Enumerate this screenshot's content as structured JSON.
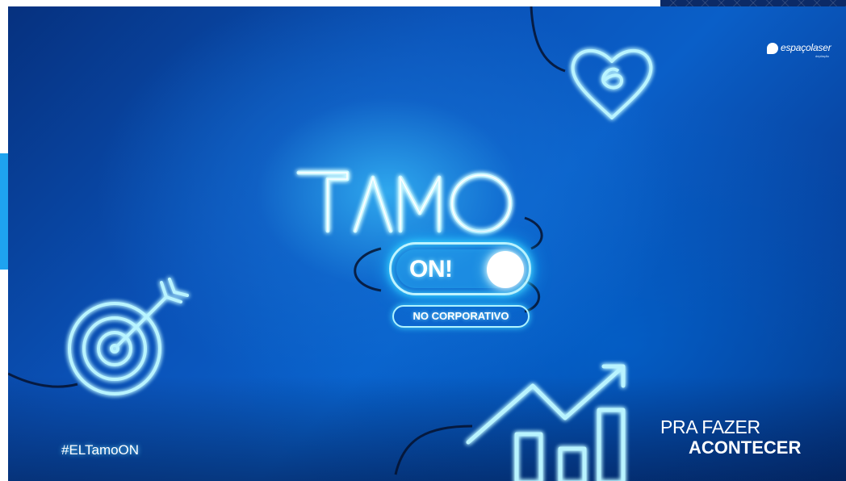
{
  "brand": {
    "logo_text": "espaçolaser",
    "logo_sub": "depilação",
    "accent": "#1ea3f0",
    "neon": "#8feaff"
  },
  "hero": {
    "title_word": "TAMO",
    "toggle_label": "ON!",
    "pill_text": "NO CORPORATIVO"
  },
  "footer": {
    "hashtag": "#ELTamoON",
    "tagline_line1": "PRA FAZER",
    "tagline_line2": "ACONTECER"
  },
  "icons": [
    "heart-e-icon",
    "target-icon",
    "growth-chart-icon"
  ]
}
